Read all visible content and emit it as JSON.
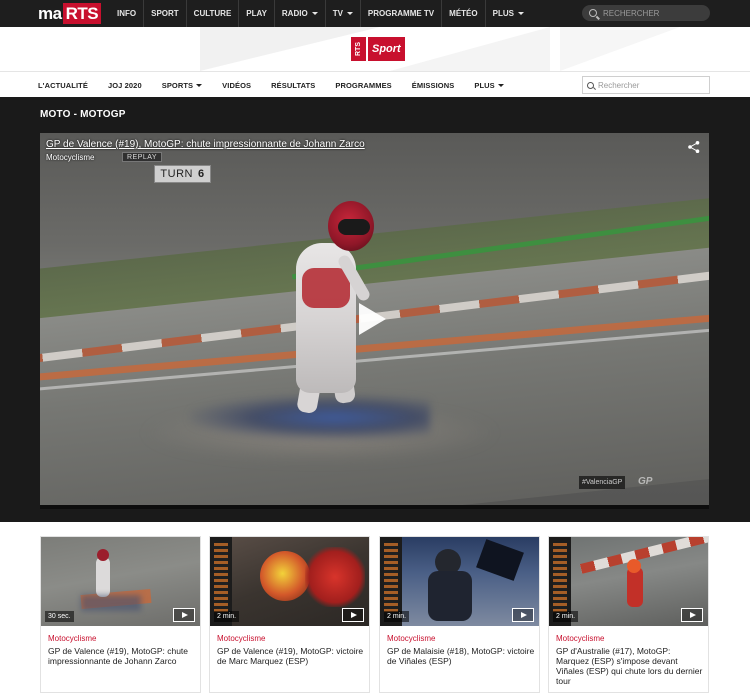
{
  "topbar": {
    "logo_ma": "ma",
    "logo_rts": "RTS",
    "nav": [
      {
        "label": "INFO",
        "caret": false
      },
      {
        "label": "SPORT",
        "caret": false
      },
      {
        "label": "CULTURE",
        "caret": false
      },
      {
        "label": "PLAY",
        "caret": false
      },
      {
        "label": "RADIO",
        "caret": true
      },
      {
        "label": "TV",
        "caret": true
      },
      {
        "label": "PROGRAMME TV",
        "caret": false
      },
      {
        "label": "MÉTÉO",
        "caret": false
      },
      {
        "label": "PLUS",
        "caret": true
      }
    ],
    "search_placeholder": "RECHERCHER"
  },
  "sport_logo": {
    "rts": "RTS",
    "sport": "Sport",
    "color": "#c8102e"
  },
  "subnav": {
    "items": [
      {
        "label": "L'ACTUALITÉ",
        "caret": false
      },
      {
        "label": "JOJ 2020",
        "caret": false
      },
      {
        "label": "SPORTS",
        "caret": true
      },
      {
        "label": "VIDÉOS",
        "caret": false
      },
      {
        "label": "RÉSULTATS",
        "caret": false
      },
      {
        "label": "PROGRAMMES",
        "caret": false
      },
      {
        "label": "ÉMISSIONS",
        "caret": false
      },
      {
        "label": "PLUS",
        "caret": true
      }
    ],
    "search_placeholder": "Rechercher"
  },
  "section": {
    "title": "MOTO - MOTOGP"
  },
  "player": {
    "title": "GP de Valence (#19), MotoGP: chute impressionnante de Johann Zarco",
    "category": "Motocyclisme",
    "replay": "REPLAY",
    "turn_label": "TURN",
    "turn_number": "6",
    "hashtag": "#ValenciaGP",
    "watermark": "GP"
  },
  "cards": [
    {
      "duration": "30 sec.",
      "category": "Motocyclisme",
      "title": "GP de Valence (#19), MotoGP: chute impressionnante de Johann Zarco"
    },
    {
      "duration": "2 min.",
      "category": "Motocyclisme",
      "title": "GP de Valence (#19), MotoGP: victoire de Marc Marquez (ESP)"
    },
    {
      "duration": "2 min.",
      "category": "Motocyclisme",
      "title": "GP de Malaisie (#18), MotoGP: victoire de Viñales (ESP)"
    },
    {
      "duration": "2 min.",
      "category": "Motocyclisme",
      "title": "GP d'Australie (#17), MotoGP: Marquez (ESP) s'impose devant Viñales (ESP) qui chute lors du dernier tour"
    }
  ]
}
